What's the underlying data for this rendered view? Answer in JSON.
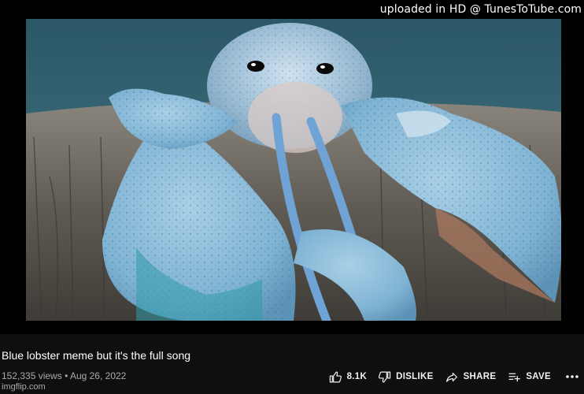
{
  "watermark": "uploaded in HD @ TunesToTube.com",
  "video": {
    "title": "Blue lobster meme but it's the full song",
    "views": "152,335 views",
    "separator": "•",
    "date": "Aug 26, 2022"
  },
  "credit": "imgflip.com",
  "actions": {
    "like_count": "8.1K",
    "dislike_label": "DISLIKE",
    "share_label": "SHARE",
    "save_label": "SAVE"
  },
  "icons": {
    "like": "thumb-up-icon",
    "dislike": "thumb-down-icon",
    "share": "share-arrow-icon",
    "save": "playlist-add-icon",
    "more": "more-horiz-icon"
  }
}
